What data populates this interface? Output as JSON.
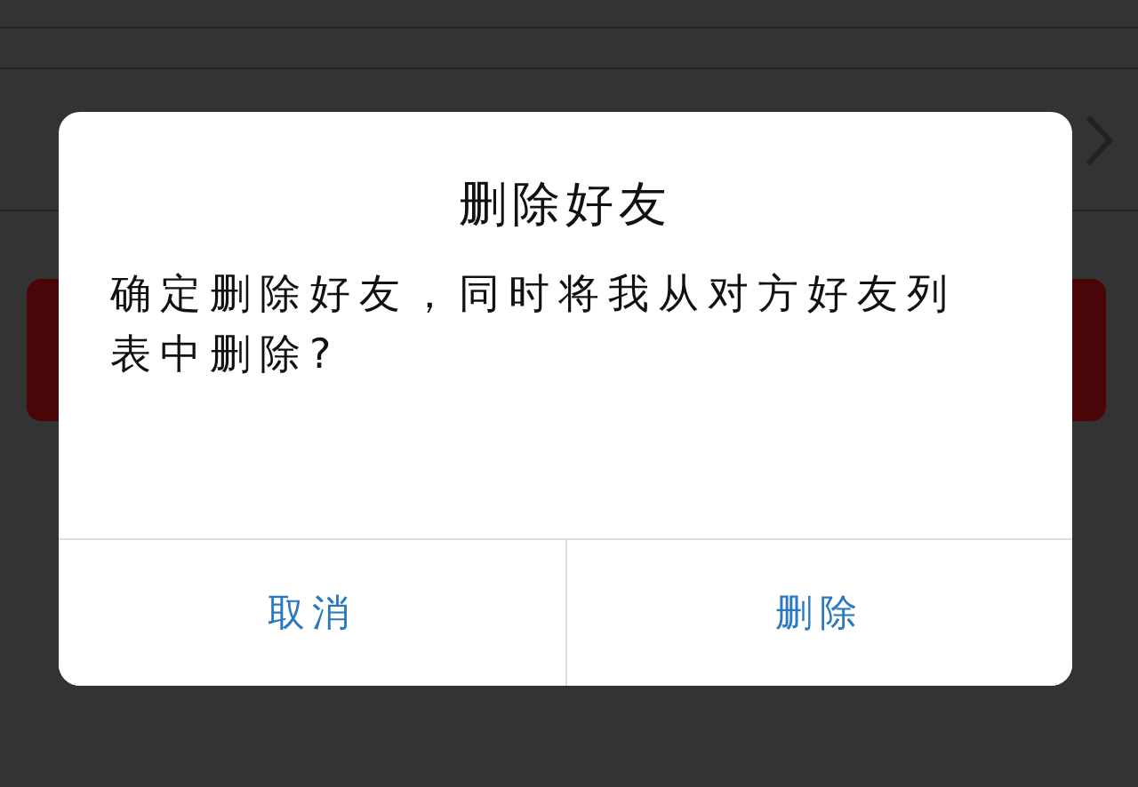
{
  "dialog": {
    "title": "删除好友",
    "message": "确定删除好友，同时将我从对方好友列表中删除?",
    "buttons": [
      {
        "label": "取消"
      },
      {
        "label": "删除"
      }
    ]
  }
}
